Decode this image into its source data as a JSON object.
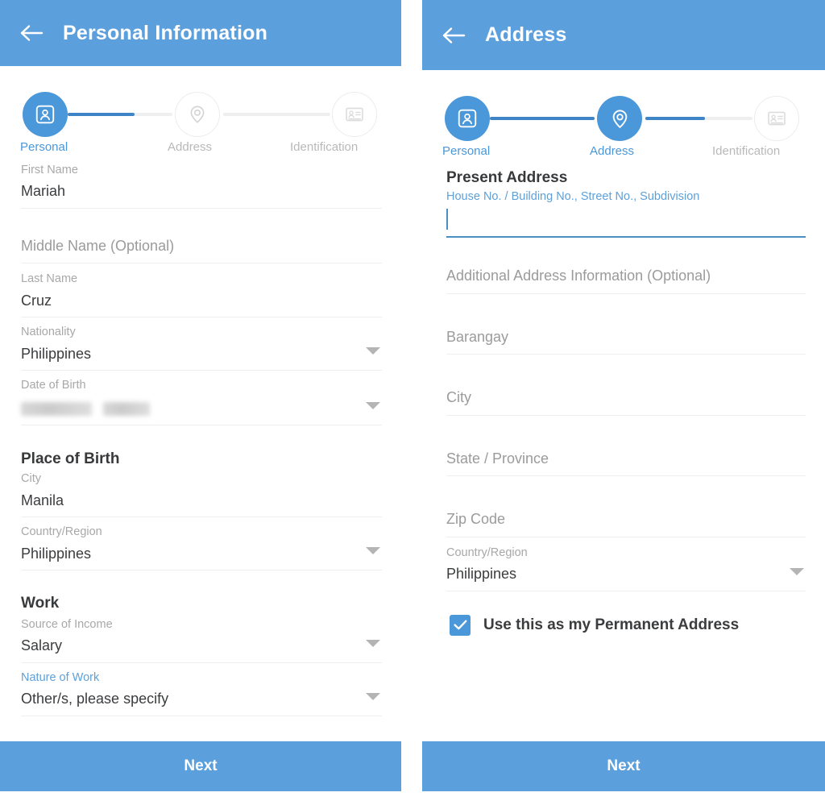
{
  "colors": {
    "appbar_blue": "#5b9fdd",
    "accent_blue": "#4a97d9",
    "active_line": "#3d85c6",
    "inactive_grey": "#b9b9b9",
    "rule_grey": "#eeeeee",
    "label_grey": "#a8a8a8",
    "value_dark": "#3b3c3e"
  },
  "left_panel": {
    "appbar": {
      "back_icon": "arrow-left-icon",
      "title": "Personal Information"
    },
    "stepper": {
      "steps": [
        {
          "id": "personal",
          "label": "Personal",
          "icon": "contact-card-icon",
          "state": "active"
        },
        {
          "id": "address",
          "label": "Address",
          "icon": "map-pin-icon",
          "state": "inactive"
        },
        {
          "id": "identification",
          "label": "Identification",
          "icon": "id-card-icon",
          "state": "inactive"
        }
      ],
      "progress": "1"
    },
    "fields": [
      {
        "name": "first-name",
        "label": "First Name",
        "value": "Mariah",
        "type": "text",
        "label_state": "normal"
      },
      {
        "name": "middle-name",
        "label": "",
        "placeholder": "Middle Name (Optional)",
        "type": "text",
        "label_state": "normal"
      },
      {
        "name": "last-name",
        "label": "Last Name",
        "value": "Cruz",
        "type": "text",
        "label_state": "normal"
      },
      {
        "name": "nationality",
        "label": "Nationality",
        "value": "Philippines",
        "type": "dropdown",
        "label_state": "normal"
      },
      {
        "name": "date-of-birth",
        "label": "Date of Birth",
        "value": "",
        "type": "dropdown",
        "label_state": "normal",
        "redacted": true
      }
    ],
    "place_of_birth": {
      "title": "Place of Birth",
      "fields": [
        {
          "name": "birth-city",
          "label": "City",
          "value": "Manila",
          "type": "text"
        },
        {
          "name": "birth-country",
          "label": "Country/Region",
          "value": "Philippines",
          "type": "dropdown"
        }
      ]
    },
    "work": {
      "title": "Work",
      "fields": [
        {
          "name": "source-of-income",
          "label": "Source of Income",
          "value": "Salary",
          "type": "dropdown",
          "label_state": "normal"
        },
        {
          "name": "nature-of-work",
          "label": "Nature of Work",
          "value": "Other/s, please specify",
          "type": "dropdown",
          "label_state": "accent"
        }
      ]
    },
    "next_button": {
      "label": "Next"
    }
  },
  "right_panel": {
    "appbar": {
      "back_icon": "arrow-left-icon",
      "title": "Address"
    },
    "stepper": {
      "steps": [
        {
          "id": "personal",
          "label": "Personal",
          "icon": "contact-card-icon",
          "state": "active"
        },
        {
          "id": "address",
          "label": "Address",
          "icon": "map-pin-icon",
          "state": "active"
        },
        {
          "id": "identification",
          "label": "Identification",
          "icon": "id-card-icon",
          "state": "inactive"
        }
      ],
      "progress": "2"
    },
    "present_address": {
      "title": "Present Address",
      "street_field": {
        "name": "street-address",
        "label": "House No. / Building No., Street No., Subdivision",
        "value": "",
        "focused": true
      }
    },
    "fields": [
      {
        "name": "additional-address",
        "label": "",
        "placeholder": "Additional Address Information (Optional)",
        "type": "text"
      },
      {
        "name": "barangay",
        "label": "",
        "placeholder": "Barangay",
        "type": "text"
      },
      {
        "name": "city",
        "label": "",
        "placeholder": "City",
        "type": "text"
      },
      {
        "name": "state-province",
        "label": "",
        "placeholder": "State / Province",
        "type": "text"
      },
      {
        "name": "zip-code",
        "label": "",
        "placeholder": "Zip Code",
        "type": "text"
      },
      {
        "name": "country-region",
        "label": "Country/Region",
        "value": "Philippines",
        "type": "dropdown"
      }
    ],
    "permanent_checkbox": {
      "label": "Use this as my Permanent Address",
      "checked": true
    },
    "next_button": {
      "label": "Next"
    }
  }
}
